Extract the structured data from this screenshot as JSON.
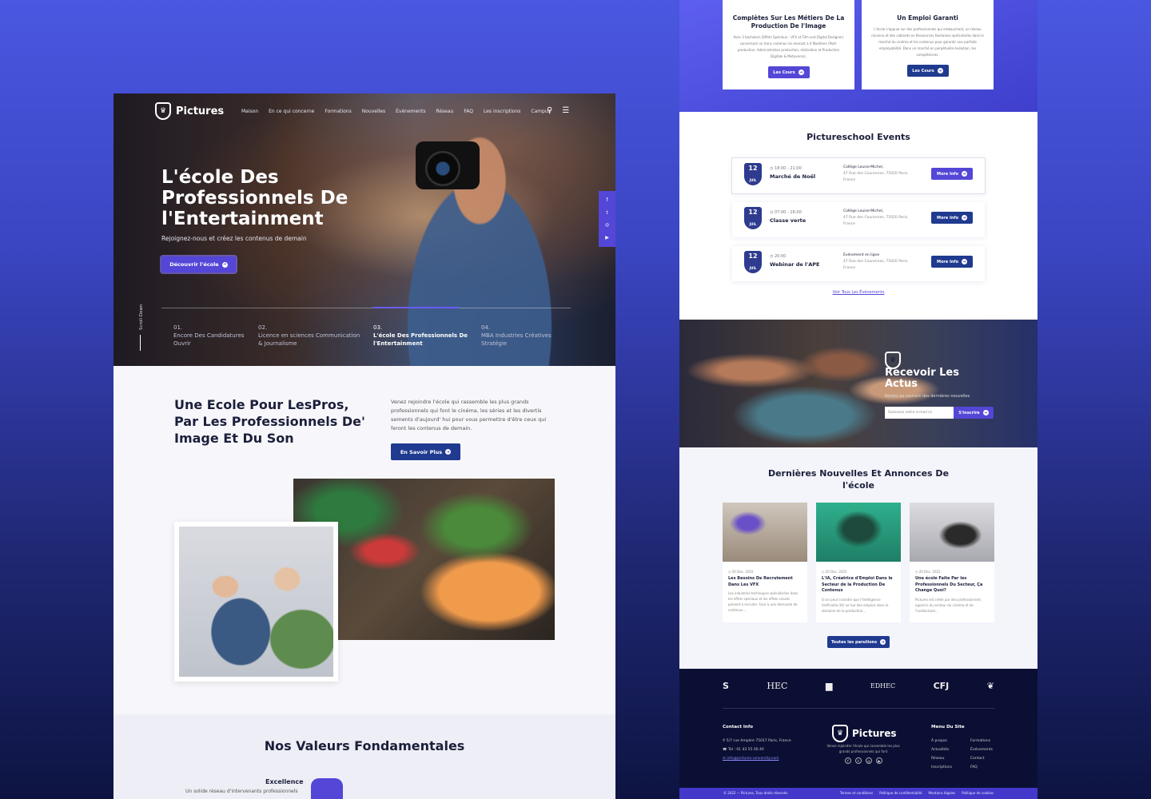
{
  "left": {
    "logo": "Pictures",
    "nav": [
      "Maison",
      "En ce qui concerne",
      "Formations",
      "Nouvelles",
      "Événements",
      "Réseau",
      "FAQ",
      "Les inscriptions",
      "Campus"
    ],
    "hero_title": "L'école Des Professionnels De l'Entertainment",
    "hero_sub": "Rejoignez-nous et créez les contenus de demain",
    "hero_btn": "Découvrir l'école",
    "scroll": "Scroll Down",
    "slides": [
      {
        "num": "01.",
        "title": "Encore Des Candidatures Ouvrir"
      },
      {
        "num": "02.",
        "title": "Licence en sciences Communication & Journalisme"
      },
      {
        "num": "03.",
        "title": "L'école Des Professionnels De l'Entertainment"
      },
      {
        "num": "04.",
        "title": "MBA Industries Créatives Stratégie"
      }
    ],
    "social": [
      "f",
      "t",
      "◎",
      "▶"
    ],
    "about_title": "Une Ecole Pour LesPros, Par Les Professionnels De' Image Et Du Son",
    "about_text": "Venez rejoindre l'école qui rassemble les plus grands professionnels qui font le cinéma, les séries et les divertis sements d'aujourd' hui pour vous permettre d'être ceux qui feront les contenus de demain.",
    "about_btn": "En Savoir Plus",
    "values_title": "Nos Valeurs Fondamentales",
    "value_name": "Excellence",
    "value_desc": "Un solide réseau d'intervenants professionnels"
  },
  "right": {
    "cards": [
      {
        "title": "Complètes Sur Les Métiers De La Production De l'Image",
        "text": "Avec 3 bachelors (Effets Spéciaux - VFX et Film and Digital Designer) concernant un tronc commun en menant à 4 Mastères (Post-production, Administration production, réalisation et Production Digitale & Metaverse).",
        "btn": "Les Cours"
      },
      {
        "title": "Un Emploi Garanti",
        "text": "L'école s'appuie sur des professionnels qui embauchent, un réseau reconnu et des cabinets en Ressources Humaines spécialisées dans le marché du cinéma et les contenus pour garantir une parfaite employabilité. Dans un marché en perpétuelle évolution, les compétences.",
        "btn": "Les Cours"
      }
    ],
    "events_title": "Pictureschool Events",
    "events": [
      {
        "day": "12",
        "month": "JUIL",
        "time": "◷ 18:00 - 21:00",
        "name": "Marché de Noël",
        "place": "Collège Louise-Michel,",
        "addr": "47 Rue des Couronnes, 75020 Paris, France",
        "btn": "More Info"
      },
      {
        "day": "12",
        "month": "JUIL",
        "time": "◷ 07:00 - 16:00",
        "name": "Classe verte",
        "place": "Collège Louise-Michel,",
        "addr": "47 Rue des Couronnes, 75020 Paris, France",
        "btn": "More Info"
      },
      {
        "day": "12",
        "month": "JUIL",
        "time": "◷ 20:00",
        "name": "Webinar de l'APE",
        "place": "Événement en ligne",
        "addr": "47 Rue des Couronnes, 75020 Paris, France",
        "btn": "More Info"
      }
    ],
    "events_link": "Voir Tous Les Événements",
    "nl_title": "Recevoir Les Actus",
    "nl_sub": "Restez au courant des dernières nouvelles",
    "nl_placeholder": "Saisissez votre e-mail ici",
    "nl_btn": "S'inscrire",
    "news_title": "Dernières Nouvelles Et Annonces De l'école",
    "news": [
      {
        "date": "◷ 20 Dec. 2022",
        "title": "Les Besoins De Recrutement Dans Les VFX",
        "text": "Les industries techniques spécialisées dans les effets spéciaux et les effets visuels peinent à recruter. Face à une demande de contenus..."
      },
      {
        "date": "◷ 20 Dec. 2022",
        "title": "L'IA, Créatrice d'Emploi Dans le Secteur de la Production De Contenus",
        "text": "Si on peut craindre que l'Intelligence Artificielle (IA) ne tue des emplois dans le domaine de la production..."
      },
      {
        "date": "◷ 20 Dec. 2022",
        "title": "Une école Faite Par les Professionnels Du Secteur, Ça Change Quoi?",
        "text": "Pictures est créée par des professionnels aguerris du secteur du cinéma et de l'audiovisuel..."
      }
    ],
    "news_btn": "Toutes les parutions",
    "partners": [
      "S",
      "HEC",
      "▆",
      "EDHEC",
      "CFJ",
      "❦"
    ],
    "contact_h": "Contact Info",
    "contact": [
      "⚲ 5/7 rue Ampère 75017 Paris, France",
      "☎ Tel : 01 43 55 00 40",
      "✉ info@pictures-university.com"
    ],
    "footer_logo": "Pictures",
    "footer_desc": "Venez rejoindre l'école qui rassemble les plus grands professionnels qui font",
    "menu_h": "Menu Du Site",
    "menu1": [
      "À propos",
      "Actualités",
      "Réseau",
      "Inscriptions"
    ],
    "menu2": [
      "Formations",
      "Événements",
      "Contact",
      "FAQ"
    ],
    "copyright": "© 2022 — Pictures, Tous droits réservés.",
    "legal": [
      "Termes et conditions",
      "Politique de confidentialité",
      "Mentions légales",
      "Politique de cookies"
    ]
  }
}
